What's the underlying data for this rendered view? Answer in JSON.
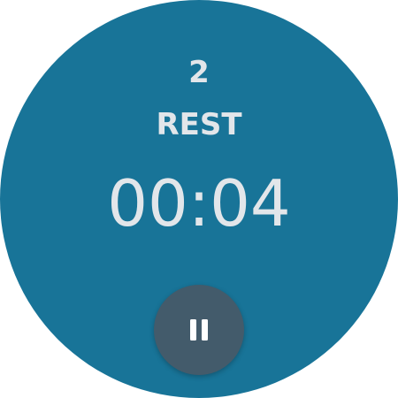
{
  "workout": {
    "set_number": "2",
    "phase": "REST",
    "timer": "00:04"
  },
  "controls": {
    "pause_icon": "pause-icon"
  },
  "colors": {
    "face": "#187498",
    "text": "#e2e6ea",
    "button": "#435b6b"
  }
}
